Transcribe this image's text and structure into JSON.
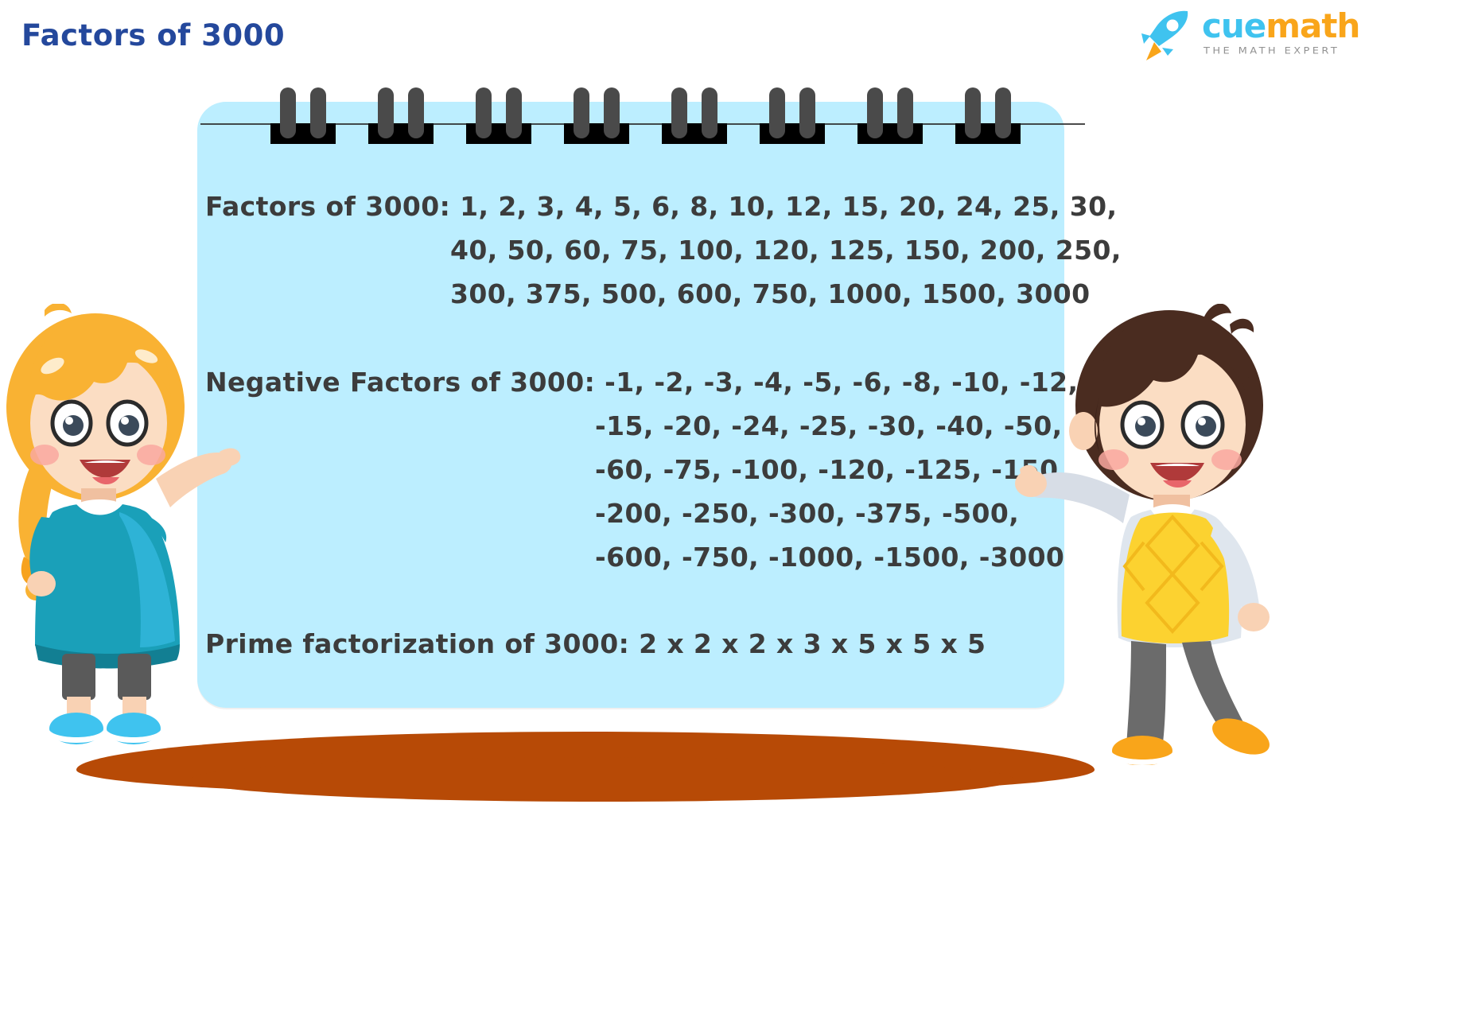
{
  "header": {
    "title": "Factors of 3000",
    "title_color": "#24489c",
    "brand": {
      "name_part1": "cue",
      "name_part2": "math",
      "tagline": "THE MATH EXPERT",
      "cue_color": "#3fc3ef",
      "math_color": "#f9a51a",
      "rocket_body_color": "#3fc3ef",
      "rocket_flame_color": "#f9a51a"
    }
  },
  "notepad": {
    "background_color": "#bceeff",
    "text_color": "#3c3c3c",
    "spiral_count": 8,
    "spiral_ring_color": "#4a4a4a",
    "blocks": [
      {
        "id": "positive-factors",
        "lines": [
          "Factors of 3000: 1, 2, 3, 4, 5, 6, 8, 10, 12, 15, 20, 24, 25, 30,",
          "40, 50, 60, 75, 100, 120, 125, 150, 200, 250,",
          "300, 375, 500, 600, 750, 1000, 1500, 3000"
        ]
      },
      {
        "id": "negative-factors",
        "lines": [
          "Negative Factors of 3000: -1, -2, -3, -4, -5, -6, -8, -10, -12,",
          "-15, -20, -24, -25, -30, -40, -50,",
          "-60, -75, -100, -120, -125, -150,",
          "-200, -250, -300, -375, -500,",
          "-600, -750, -1000, -1500, -3000"
        ]
      },
      {
        "id": "prime-factorization",
        "lines": [
          "Prime factorization of 3000: 2 x 2 x 2 x 3 x 5 x 5 x 5"
        ]
      }
    ]
  },
  "illustration": {
    "ground_shadow_color": "#b74a06",
    "girl": {
      "hair_color": "#f9b233",
      "dress_color": "#1aa0b9",
      "shoe_color": "#3fc3ef",
      "skin_color": "#f9d2b4"
    },
    "boy": {
      "hair_color": "#4a2c20",
      "vest_color": "#fcd230",
      "pants_color": "#6b6b6b",
      "shoe_color": "#f9a51a",
      "skin_color": "#f9d2b4"
    }
  }
}
